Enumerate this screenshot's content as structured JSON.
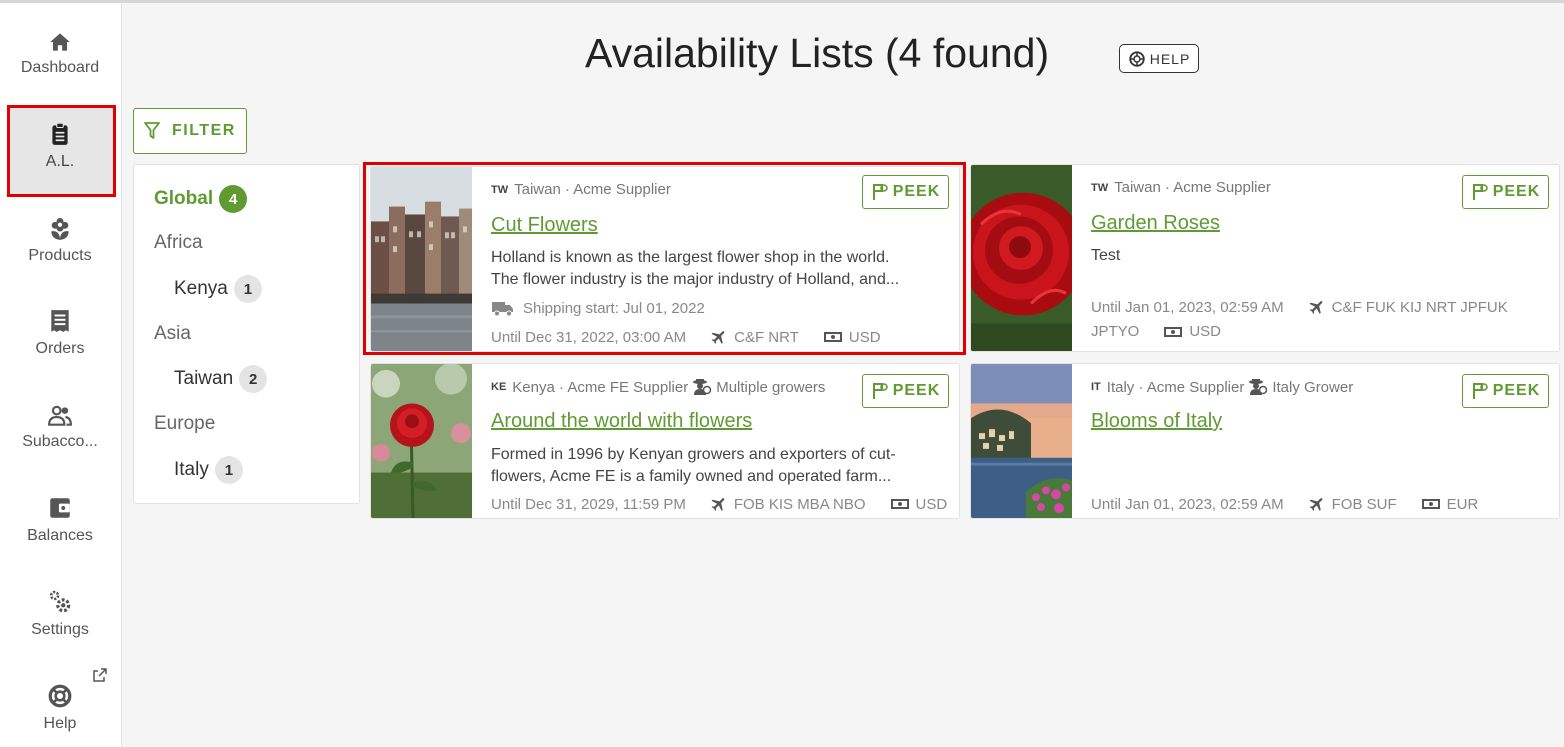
{
  "sidebar": {
    "items": [
      {
        "label": "Dashboard",
        "icon": "home-icon"
      },
      {
        "label": "A.L.",
        "icon": "clipboard-icon"
      },
      {
        "label": "Products",
        "icon": "flower-icon"
      },
      {
        "label": "Orders",
        "icon": "receipt-icon"
      },
      {
        "label": "Subacco...",
        "icon": "people-icon"
      },
      {
        "label": "Balances",
        "icon": "wallet-icon"
      },
      {
        "label": "Settings",
        "icon": "gears-icon"
      },
      {
        "label": "Help",
        "icon": "lifebuoy-icon"
      }
    ],
    "active": "A.L."
  },
  "header": {
    "title": "Availability Lists (4 found)",
    "help_label": "HELP"
  },
  "filter_label": "FILTER",
  "regions": {
    "global": {
      "label": "Global",
      "count": "4"
    },
    "groups": [
      {
        "label": "Africa",
        "countries": [
          {
            "label": "Kenya",
            "count": "1"
          }
        ]
      },
      {
        "label": "Asia",
        "countries": [
          {
            "label": "Taiwan",
            "count": "2"
          }
        ]
      },
      {
        "label": "Europe",
        "countries": [
          {
            "label": "Italy",
            "count": "1"
          }
        ]
      }
    ]
  },
  "cards": [
    {
      "country_code": "TW",
      "location": "Taiwan · Acme Supplier",
      "grower": "",
      "title": "Cut Flowers",
      "desc_line1": "Holland is known as the largest flower shop in the world.",
      "desc_line2": "The flower industry is the major industry of Holland, and...",
      "shipping": "Shipping start:  Jul 01, 2022",
      "until": "Until Dec 31, 2022, 03:00 AM",
      "terms": "C&F NRT",
      "currency": "USD",
      "peek_label": "PEEK"
    },
    {
      "country_code": "TW",
      "location": "Taiwan · Acme Supplier",
      "grower": "",
      "title": "Garden Roses",
      "desc_line1": "Test",
      "until": "Until Jan 01, 2023, 02:59 AM",
      "terms": "C&F FUK KIJ NRT JPFUK",
      "terms2": "JPTYO",
      "currency": "USD",
      "peek_label": "PEEK"
    },
    {
      "country_code": "KE",
      "location": "Kenya · Acme FE Supplier",
      "grower": "Multiple growers",
      "title": "Around the world with flowers",
      "desc_line1": "Formed in 1996 by Kenyan growers and exporters of cut-",
      "desc_line2": "flowers, Acme FE is a family owned and operated farm...",
      "until": "Until Dec 31, 2029, 11:59 PM",
      "terms": "FOB KIS MBA NBO",
      "currency": "USD",
      "peek_label": "PEEK"
    },
    {
      "country_code": "IT",
      "location": "Italy · Acme Supplier",
      "grower": "Italy Grower",
      "title": "Blooms of Italy",
      "until": "Until Jan 01, 2023, 02:59 AM",
      "terms": "FOB SUF",
      "currency": "EUR",
      "peek_label": "PEEK"
    }
  ],
  "colors": {
    "accent": "#5f9b32",
    "highlight": "#e00000"
  }
}
